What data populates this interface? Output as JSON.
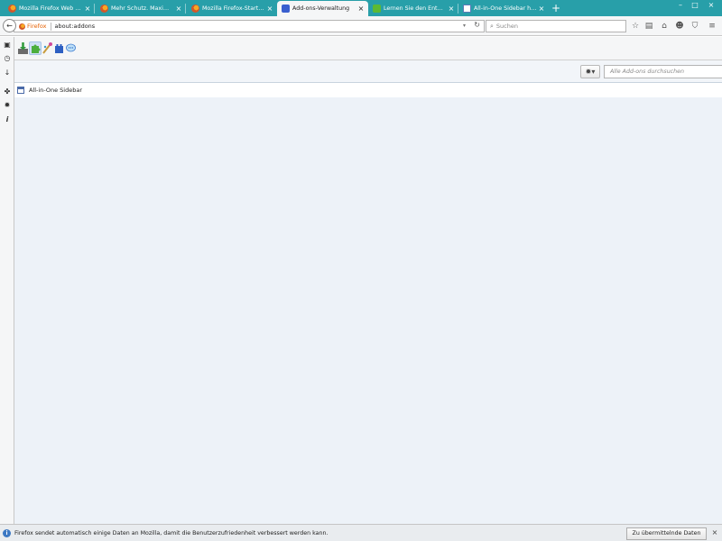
{
  "tabs": [
    {
      "label": "Mozilla Firefox Web Brows...",
      "favicon": "firefox-icon"
    },
    {
      "label": "Mehr Schutz. Maximale Pr...",
      "favicon": "firefox-icon"
    },
    {
      "label": "Mozilla Firefox-Startseite",
      "favicon": "firefox-icon"
    },
    {
      "label": "Add-ons-Verwaltung",
      "favicon": "addons-icon",
      "active": true
    },
    {
      "label": "Lernen Sie den Entwickler...",
      "favicon": "puzzle-icon"
    },
    {
      "label": "All-in-One Sidebar has be...",
      "favicon": "page-icon"
    }
  ],
  "tab_close_glyph": "×",
  "new_tab_glyph": "+",
  "window_controls": {
    "minimize": "–",
    "maximize": "□",
    "close": "×"
  },
  "urlbar": {
    "identity_label": "Firefox",
    "url": "about:addons",
    "dropdown_glyph": "▾",
    "reload_glyph": "↻"
  },
  "search": {
    "placeholder": "Suchen",
    "glyph": "⌕"
  },
  "nav_glyphs": {
    "back": "←",
    "bookmark": "☆",
    "reading_list": "▤",
    "home": "⌂",
    "sync": "☻",
    "pocket": "⛉",
    "menu": "≡"
  },
  "sidebar_glyphs": {
    "page": "▣",
    "history": "◷",
    "downloads": "↓",
    "addons": "✤",
    "settings": "✹",
    "info": "i"
  },
  "addon_search": {
    "placeholder": "Alle Add-ons durchsuchen",
    "glyph": "⌕"
  },
  "gear_menu_glyph": "✹▾",
  "addons_list": [
    {
      "name": "All-in-One Sidebar"
    }
  ],
  "notification": {
    "message": "Firefox sendet automatisch einige Daten an Mozilla, damit die Benutzerzufriedenheit verbessert werden kann.",
    "button_label": "Zu übermittelnde Daten festlegen",
    "close_glyph": "×",
    "info_glyph": "i"
  },
  "colors": {
    "tabbar": "#289fa9",
    "content_bg": "#edf2f8",
    "accent": "#3c78c3"
  }
}
